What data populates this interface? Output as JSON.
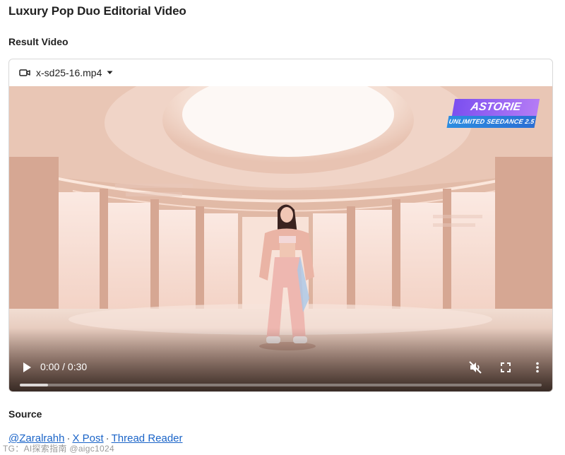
{
  "page": {
    "title": "Luxury Pop Duo Editorial Video"
  },
  "result": {
    "heading": "Result Video",
    "file_name": "x-sd25-16.mp4",
    "file_icon": "video-camera-icon",
    "dropdown_icon": "caret-down-icon"
  },
  "video": {
    "brand_top": "ASTORIE",
    "brand_bottom": "UNLIMITED SEEDANCE 2.5",
    "current_time": "0:00",
    "duration": "0:30",
    "time_separator": " / ",
    "muted": true,
    "playback_progress": 0,
    "buffered_fraction": 0.054,
    "icons": {
      "play": "play-icon",
      "mute": "volume-muted-icon",
      "fullscreen": "fullscreen-icon",
      "more": "more-vertical-icon"
    }
  },
  "source": {
    "heading": "Source",
    "links": [
      {
        "label": "@Zaralrahh"
      },
      {
        "label": "X Post"
      },
      {
        "label": "Thread Reader"
      }
    ],
    "separator": "·"
  },
  "watermark": "TG：AI探索指南 @aigc1024",
  "colors": {
    "link": "#1a64c8",
    "brand_purple": "#8b5cf6",
    "brand_blue": "#2d8de0"
  }
}
